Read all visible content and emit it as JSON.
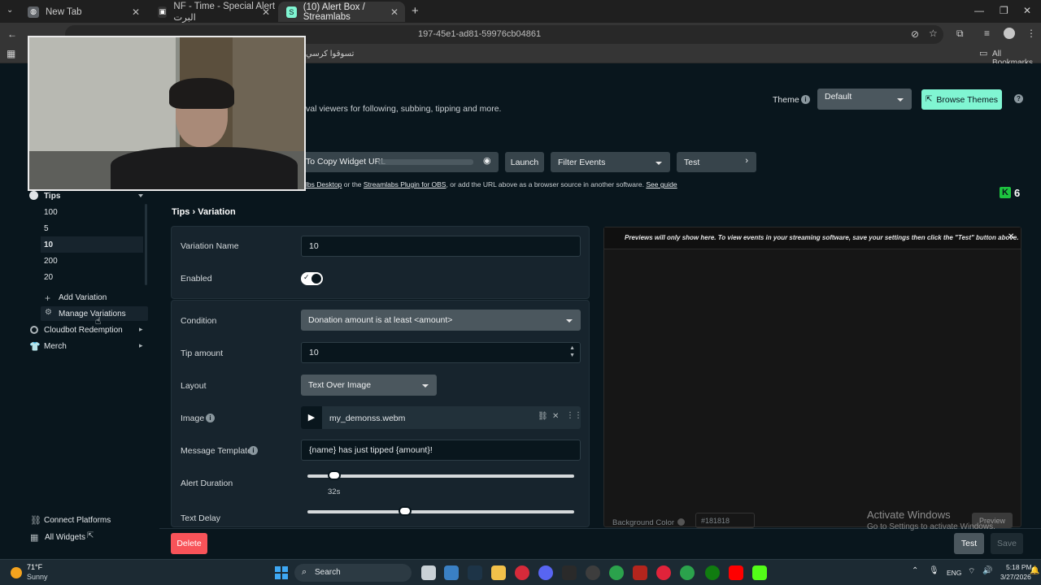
{
  "browser": {
    "tabs": [
      {
        "title": "New Tab"
      },
      {
        "title": "NF - Time - Special Alert البرت"
      },
      {
        "title": "(10) Alert Box / Streamlabs"
      }
    ],
    "url": "197-45e1-ad81-59976cb04861",
    "bookmark": "تسوقوا كرسي",
    "all_bookmarks": "All Bookmarks"
  },
  "header": {
    "subtitle": "val viewers for following, subbing, tipping and more.",
    "theme_label": "Theme",
    "theme_value": "Default",
    "browse_themes": "Browse Themes",
    "copy_widget": "To Copy Widget URL",
    "launch": "Launch",
    "filter_events": "Filter Events",
    "test": "Test",
    "hint_a": "lbs Desktop",
    "hint_b": " or the ",
    "hint_c": "Streamlabs Plugin for OBS",
    "hint_d": ", or add the URL above as a browser source in another software. ",
    "hint_e": "See guide",
    "kick_count": "6"
  },
  "sidebar": {
    "group": "Tips",
    "variations": [
      "100",
      "5",
      "10",
      "200",
      "20"
    ],
    "selected": "10",
    "add_variation": "Add Variation",
    "manage_variations": "Manage Variations",
    "cloudbot": "Cloudbot Redemption",
    "merch": "Merch",
    "connect_platforms": "Connect Platforms",
    "all_widgets": "All Widgets"
  },
  "breadcrumb": {
    "root": "Tips",
    "sep": "›",
    "current": "Variation"
  },
  "form": {
    "variation_name_label": "Variation Name",
    "variation_name_value": "10",
    "enabled_label": "Enabled",
    "condition_label": "Condition",
    "condition_value": "Donation amount is at least <amount>",
    "tip_amount_label": "Tip amount",
    "tip_amount_value": "10",
    "layout_label": "Layout",
    "layout_value": "Text Over Image",
    "image_label": "Image",
    "image_value": "my_demonss.webm",
    "message_label": "Message Template",
    "message_value": "{name} has just tipped {amount}!",
    "duration_label": "Alert Duration",
    "duration_value": "32s",
    "text_delay_label": "Text Delay"
  },
  "preview": {
    "notice": "Previews will only show here. To view events in your streaming software, save your settings then click the \"Test\" button above.",
    "bg_label": "Background Color",
    "bg_value": "#181818",
    "preview_btn": "Preview"
  },
  "footer": {
    "delete": "Delete",
    "test": "Test",
    "save": "Save"
  },
  "watermark": {
    "title": "Activate Windows",
    "sub": "Go to Settings to activate Windows."
  },
  "taskbar": {
    "weather_temp": "71°F",
    "weather_desc": "Sunny",
    "search": "Search",
    "lang": "ENG",
    "time": "5:18 PM",
    "date": "3/27/2026"
  },
  "colors": {
    "accent": "#80f5d2",
    "danger": "#f85359",
    "bg": "#09161d",
    "card": "#17242d"
  }
}
